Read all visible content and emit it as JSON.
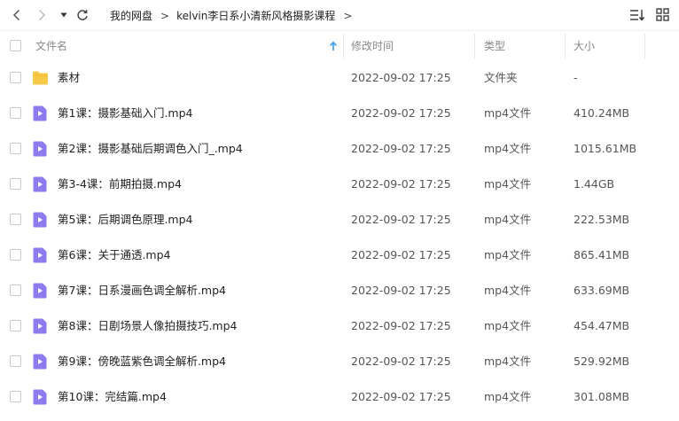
{
  "breadcrumb": [
    "我的网盘",
    "kelvin李日系小清新风格摄影课程"
  ],
  "breadcrumb_sep": ">",
  "header": {
    "name": "文件名",
    "modified": "修改时间",
    "type": "类型",
    "size": "大小"
  },
  "files": [
    {
      "kind": "folder",
      "name": "素材",
      "modified": "2022-09-02 17:25",
      "type": "文件夹",
      "size": "-"
    },
    {
      "kind": "video",
      "name": "第1课：摄影基础入门.mp4",
      "modified": "2022-09-02 17:25",
      "type": "mp4文件",
      "size": "410.24MB"
    },
    {
      "kind": "video",
      "name": "第2课：摄影基础后期调色入门_.mp4",
      "modified": "2022-09-02 17:25",
      "type": "mp4文件",
      "size": "1015.61MB"
    },
    {
      "kind": "video",
      "name": "第3-4课：前期拍摄.mp4",
      "modified": "2022-09-02 17:25",
      "type": "mp4文件",
      "size": "1.44GB"
    },
    {
      "kind": "video",
      "name": "第5课：后期调色原理.mp4",
      "modified": "2022-09-02 17:25",
      "type": "mp4文件",
      "size": "222.53MB"
    },
    {
      "kind": "video",
      "name": "第6课：关于通透.mp4",
      "modified": "2022-09-02 17:25",
      "type": "mp4文件",
      "size": "865.41MB"
    },
    {
      "kind": "video",
      "name": "第7课：日系漫画色调全解析.mp4",
      "modified": "2022-09-02 17:25",
      "type": "mp4文件",
      "size": "633.69MB"
    },
    {
      "kind": "video",
      "name": "第8课：日剧场景人像拍摄技巧.mp4",
      "modified": "2022-09-02 17:25",
      "type": "mp4文件",
      "size": "454.47MB"
    },
    {
      "kind": "video",
      "name": "第9课：傍晚蓝紫色调全解析.mp4",
      "modified": "2022-09-02 17:25",
      "type": "mp4文件",
      "size": "529.92MB"
    },
    {
      "kind": "video",
      "name": "第10课：完结篇.mp4",
      "modified": "2022-09-02 17:25",
      "type": "mp4文件",
      "size": "301.08MB"
    }
  ],
  "icons": {
    "back": "chevron-left-icon",
    "forward": "chevron-right-icon",
    "history": "caret-down-icon",
    "refresh": "refresh-icon",
    "sort": "sort-icon",
    "grid": "grid-view-icon",
    "folder": "folder-icon",
    "video": "video-file-icon",
    "sort_arrow": "arrow-up-icon"
  },
  "colors": {
    "folder": "#f7c948",
    "video": "#8c7cf0",
    "sort_arrow": "#3b9be8"
  }
}
